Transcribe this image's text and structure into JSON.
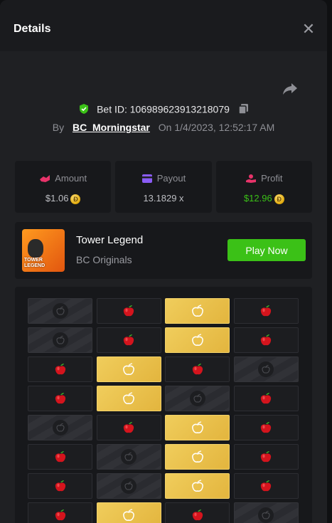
{
  "modal": {
    "title": "Details",
    "bet_id": "Bet ID: 106989623913218079",
    "by_label": "By",
    "username": "BC_Morningstar",
    "on_label": "On",
    "datetime": "1/4/2023, 12:52:17 AM"
  },
  "stats": {
    "amount": {
      "label": "Amount",
      "value": "$1.06"
    },
    "payout": {
      "label": "Payout",
      "value": "13.1829 x"
    },
    "profit": {
      "label": "Profit",
      "value": "$12.96"
    }
  },
  "coin_glyph": "Đ",
  "game": {
    "name": "Tower Legend",
    "provider": "BC Originals",
    "play_label": "Play Now",
    "thumb_logo": "TOWER LEGEND"
  },
  "colors": {
    "accent_green": "#3bc117",
    "gold_tile": "#e8c04a",
    "apple_red": "#d4141d"
  },
  "board": {
    "rows": [
      [
        "dark",
        "apple",
        "gold",
        "apple"
      ],
      [
        "dark",
        "apple",
        "gold",
        "apple"
      ],
      [
        "apple",
        "gold",
        "apple",
        "dark"
      ],
      [
        "apple",
        "gold",
        "dark",
        "apple"
      ],
      [
        "dark",
        "apple",
        "gold",
        "apple"
      ],
      [
        "apple",
        "dark",
        "gold",
        "apple"
      ],
      [
        "apple",
        "dark",
        "gold",
        "apple"
      ],
      [
        "apple",
        "gold",
        "apple",
        "dark"
      ]
    ]
  }
}
